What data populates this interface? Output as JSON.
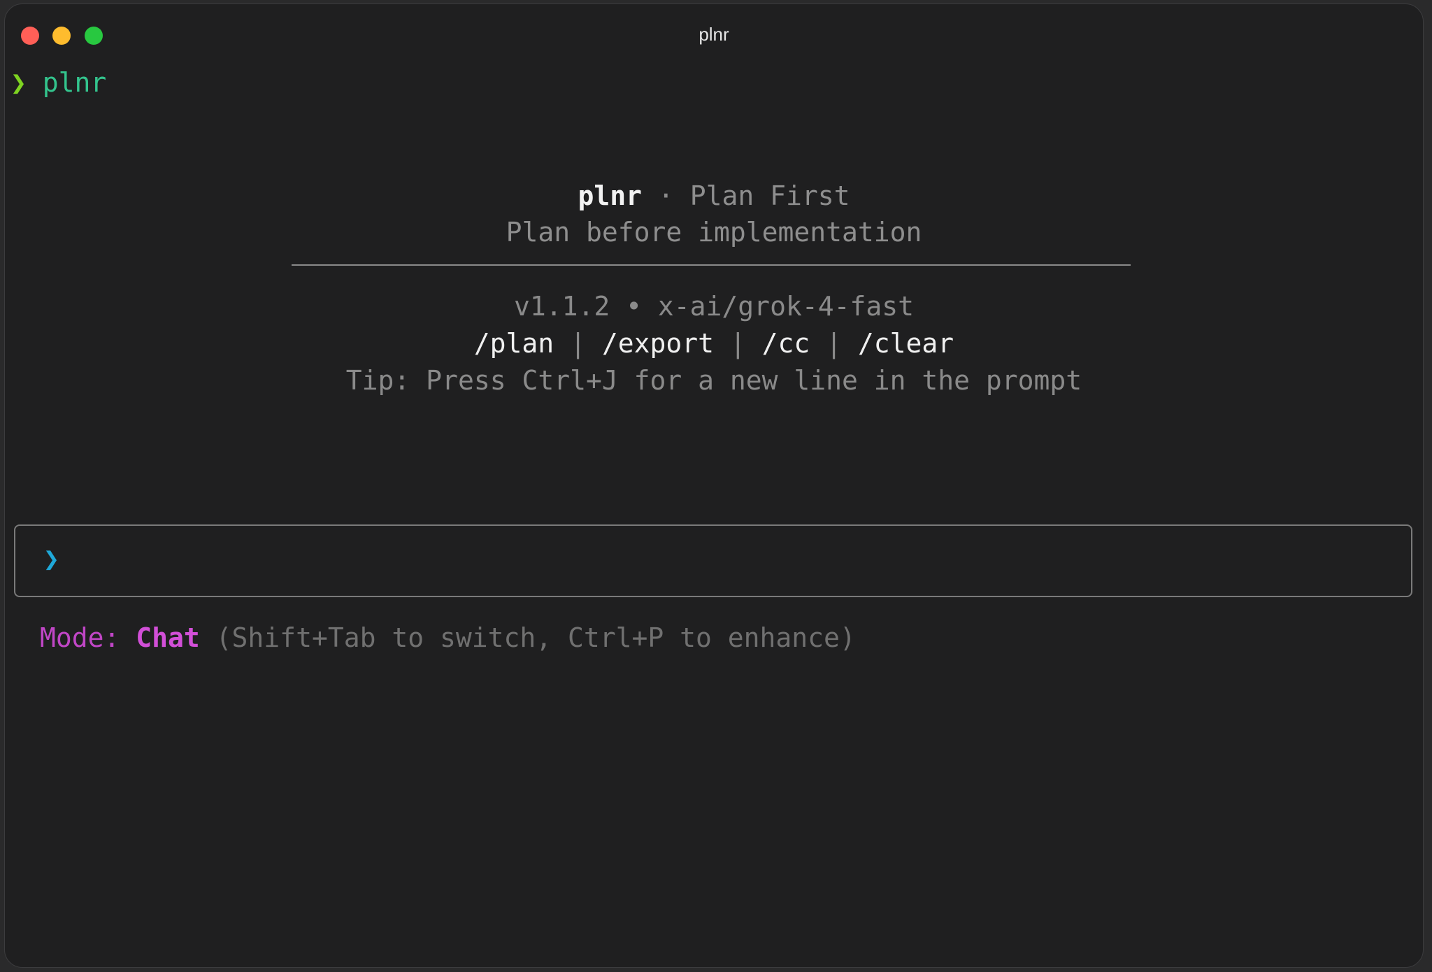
{
  "window": {
    "title": "plnr"
  },
  "shell": {
    "prompt_symbol": "❯",
    "command": "plnr"
  },
  "banner": {
    "app_name": "plnr",
    "separator": " · ",
    "tagline": "Plan First",
    "subtitle": "Plan before implementation",
    "version_line": "v1.1.2 • x-ai/grok-4-fast",
    "commands": [
      "/plan",
      "/export",
      "/cc",
      "/clear"
    ],
    "command_separator": " | ",
    "tip": "Tip: Press Ctrl+J for a new line in the prompt"
  },
  "prompt": {
    "symbol": "❯",
    "value": ""
  },
  "mode": {
    "label": "Mode: ",
    "value": "Chat",
    "hint": " (Shift+Tab to switch, Ctrl+P to enhance)"
  },
  "colors": {
    "close": "#ff5f57",
    "minimize": "#febc2e",
    "maximize": "#28c840",
    "shell_arrow": "#7ed321",
    "shell_command": "#33c48d",
    "prompt_arrow": "#1fa8d8",
    "mode_accent": "#d24fd8"
  }
}
